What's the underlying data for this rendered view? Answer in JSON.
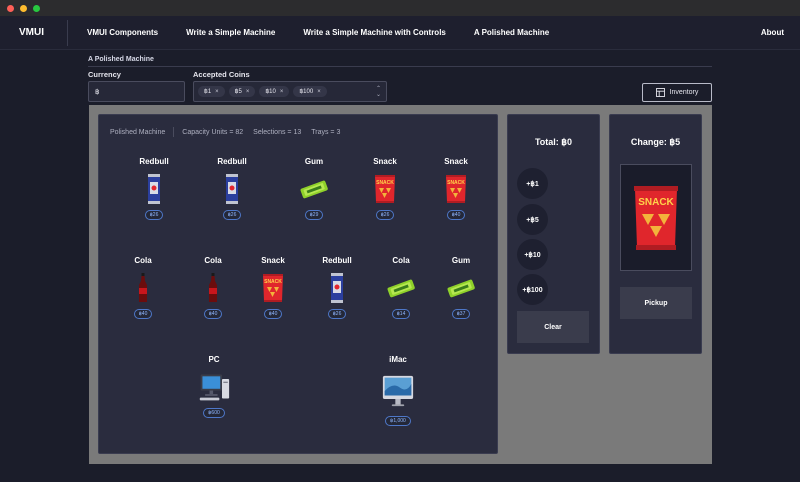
{
  "nav": {
    "brand": "VMUI",
    "links": [
      "VMUI Components",
      "Write a Simple Machine",
      "Write a Simple Machine with Controls",
      "A Polished Machine"
    ],
    "about": "About"
  },
  "page": {
    "section_title": "A Polished Machine",
    "currency_label": "Currency",
    "currency_value": "฿",
    "coins_label": "Accepted Coins",
    "coins": [
      "฿1",
      "฿5",
      "฿10",
      "฿100"
    ],
    "inventory_label": "Inventory"
  },
  "machine": {
    "stats": {
      "name": "Polished Machine",
      "capacity": "Capacity Units = 82",
      "selections": "Selections = 13",
      "trays": "Trays = 3"
    },
    "trays": [
      [
        {
          "name": "Redbull",
          "price": "฿26",
          "icon": "redbull-can-icon"
        },
        {
          "name": "Redbull",
          "price": "฿26",
          "icon": "redbull-can-icon"
        },
        {
          "name": "Gum",
          "price": "฿29",
          "icon": "gum-pack-icon"
        },
        {
          "name": "Snack",
          "price": "฿26",
          "icon": "snack-bag-icon"
        },
        {
          "name": "Snack",
          "price": "฿40",
          "icon": "snack-bag-icon"
        }
      ],
      [
        {
          "name": "Cola",
          "price": "฿40",
          "icon": "cola-bottle-icon"
        },
        {
          "name": "Cola",
          "price": "฿40",
          "icon": "cola-bottle-icon"
        },
        {
          "name": "Snack",
          "price": "฿40",
          "icon": "snack-bag-icon"
        },
        {
          "name": "Redbull",
          "price": "฿26",
          "icon": "redbull-can-icon"
        },
        {
          "name": "Cola",
          "price": "฿14",
          "icon": "gum-pack-icon"
        },
        {
          "name": "Gum",
          "price": "฿37",
          "icon": "gum-pack-icon"
        }
      ],
      [
        {
          "name": "PC",
          "price": "฿600",
          "icon": "pc-icon"
        },
        {
          "name": "iMac",
          "price": "฿1,000",
          "icon": "imac-icon"
        }
      ]
    ],
    "total": "Total: ฿0",
    "coin_buttons": [
      "+฿1",
      "+฿5",
      "+฿10",
      "+฿100"
    ],
    "clear_label": "Clear",
    "change": "Change: ฿5",
    "pickup_label": "Pickup",
    "snack_text": "SNACK"
  }
}
